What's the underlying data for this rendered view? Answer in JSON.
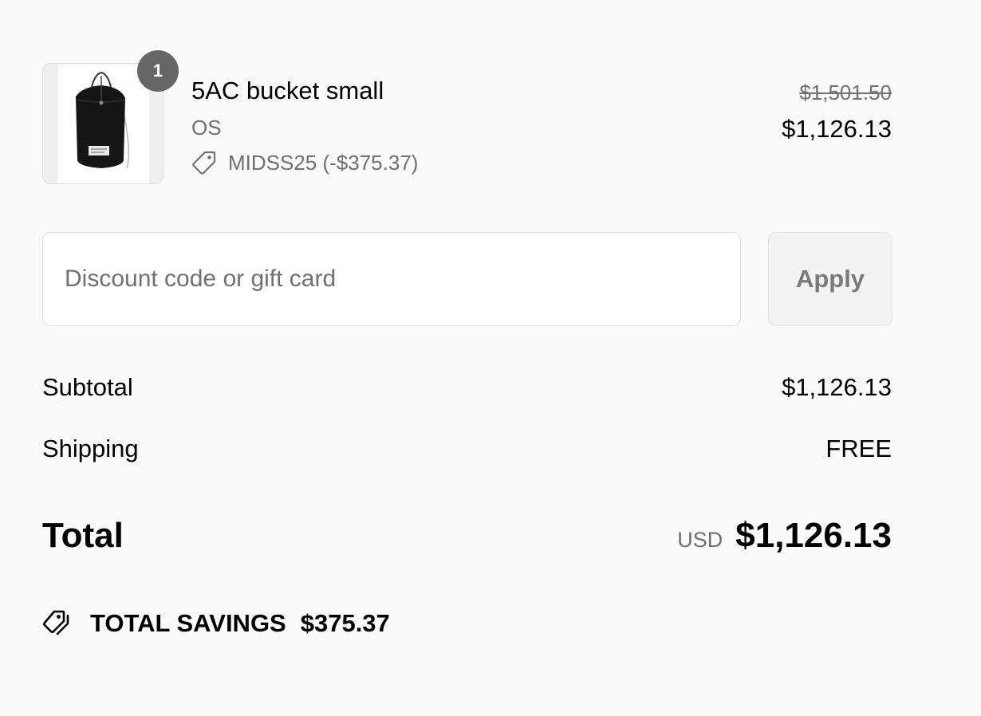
{
  "product": {
    "quantity": "1",
    "name": "5AC bucket small",
    "variant": "OS",
    "discount_code": "MIDSS25 (-$375.37)",
    "price_original": "$1,501.50",
    "price_final": "$1,126.13",
    "image_icon": "bag-photo"
  },
  "discount_form": {
    "placeholder": "Discount code or gift card",
    "value": "",
    "apply_label": "Apply"
  },
  "totals": {
    "subtotal_label": "Subtotal",
    "subtotal_value": "$1,126.13",
    "shipping_label": "Shipping",
    "shipping_value": "FREE",
    "total_label": "Total",
    "currency": "USD",
    "total_value": "$1,126.13"
  },
  "savings": {
    "icon": "tags-icon",
    "label": "TOTAL SAVINGS",
    "amount": "$375.37"
  },
  "colors": {
    "background": "#fafafa",
    "badge": "#666666",
    "muted_text": "#707070",
    "button_bg": "#f3f3f3"
  }
}
